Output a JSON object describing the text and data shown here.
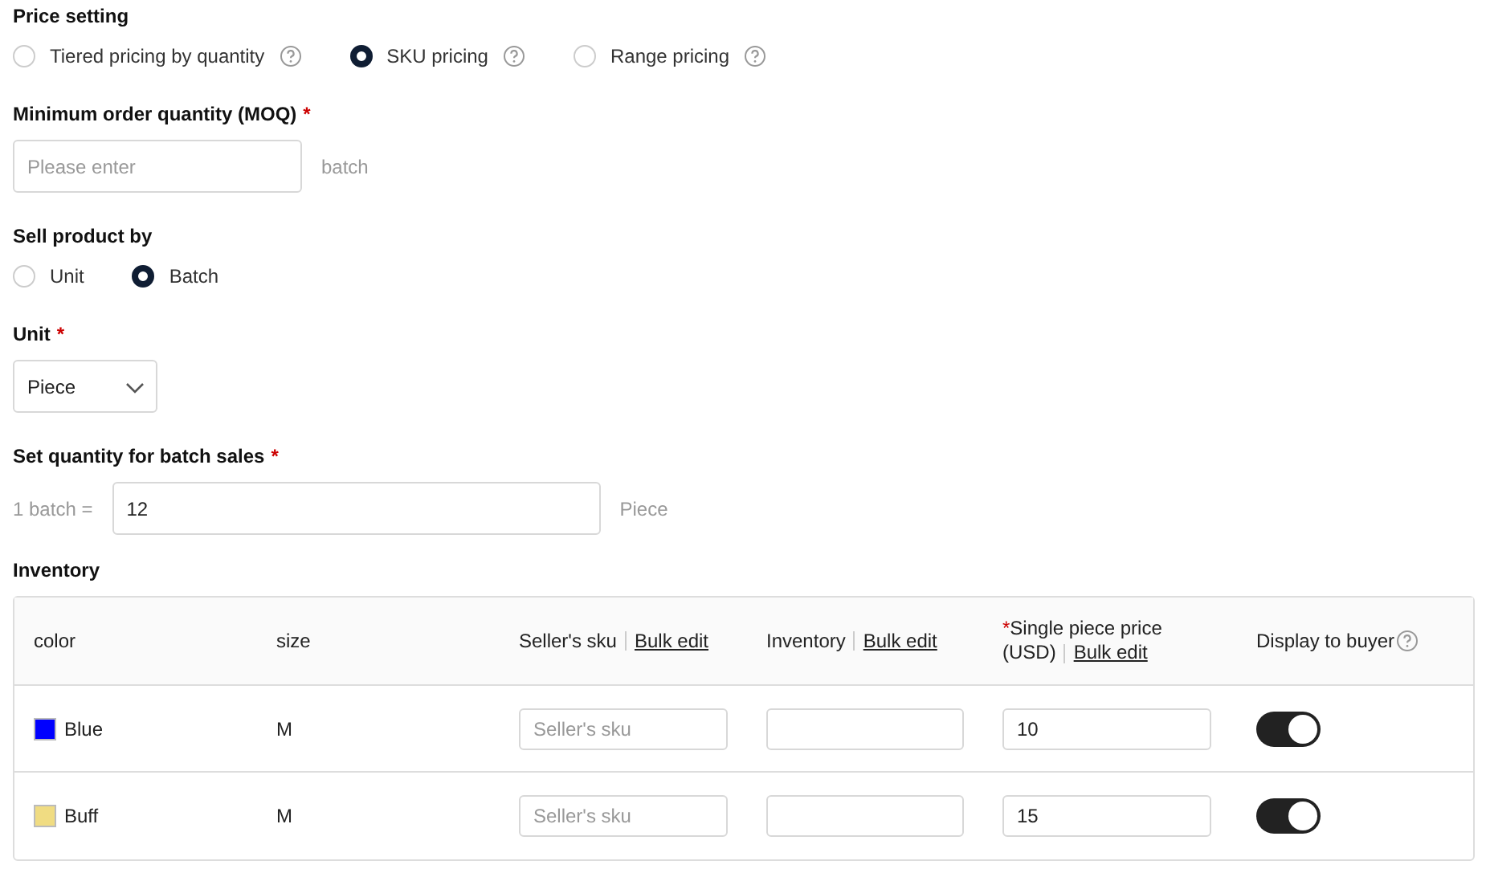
{
  "price_setting": {
    "label": "Price setting",
    "options": [
      {
        "label": "Tiered pricing by quantity",
        "selected": false,
        "help": true
      },
      {
        "label": "SKU pricing",
        "selected": true,
        "help": true
      },
      {
        "label": "Range pricing",
        "selected": false,
        "help": true
      }
    ]
  },
  "moq": {
    "label": "Minimum order quantity (MOQ)",
    "mark": "*",
    "placeholder": "Please enter",
    "suffix": "batch"
  },
  "sell_by": {
    "label": "Sell product by",
    "options": [
      {
        "label": "Unit",
        "selected": false
      },
      {
        "label": "Batch",
        "selected": true
      }
    ]
  },
  "unit": {
    "label": "Unit",
    "mark": "*",
    "value": "Piece"
  },
  "batch_quantity": {
    "label": "Set quantity for batch sales",
    "mark": "*",
    "prefix": "1 batch =",
    "value": "12",
    "suffix": "Piece"
  },
  "inventory": {
    "label": "Inventory",
    "columns": [
      {
        "label": "color"
      },
      {
        "label": "size"
      },
      {
        "label": "Seller's sku",
        "action": "Bulk edit"
      },
      {
        "label": "Inventory",
        "action": "Bulk edit"
      },
      {
        "label": "Single piece price",
        "label_unit": "(USD)",
        "action": "Bulk edit",
        "mark": "*"
      },
      {
        "label": "Display to buyer",
        "help": true
      }
    ],
    "rows": [
      {
        "color_name": "Blue",
        "color": "#0000ff",
        "size": "M",
        "sku_placeholder": "Seller's sku",
        "price": "10",
        "display": true
      },
      {
        "color_name": "Buff",
        "color": "#f0dc82",
        "size": "M",
        "sku_placeholder": "Seller's sku",
        "price": "15",
        "display": true
      }
    ]
  }
}
